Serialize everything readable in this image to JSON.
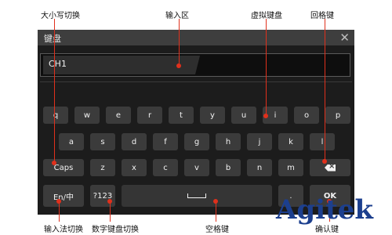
{
  "annotations": {
    "case_switch": "大小写切换",
    "input_area": "输入区",
    "virtual_keyboard": "虚拟键盘",
    "backspace": "回格键",
    "input_method_switch": "输入法切换",
    "numeric_keyboard_switch": "数字键盘切换",
    "space_key": "空格键",
    "confirm_key": "确认键"
  },
  "dialog": {
    "title": "键盘",
    "close_icon": "close-icon"
  },
  "input": {
    "value": "CH1"
  },
  "keys": {
    "row1": [
      "q",
      "w",
      "e",
      "r",
      "t",
      "y",
      "u",
      "i",
      "o",
      "p"
    ],
    "row2": [
      "a",
      "s",
      "d",
      "f",
      "g",
      "h",
      "j",
      "k",
      "l"
    ],
    "row3": [
      "z",
      "x",
      "c",
      "v",
      "b",
      "n",
      "m"
    ],
    "caps": "Caps",
    "backspace_icon": "backspace-icon",
    "lang": "En/中",
    "num": "?123",
    "dot": ".",
    "ok": "OK"
  },
  "brand": {
    "text": "Agitek"
  },
  "colors": {
    "annotation_line": "#e0301c",
    "brand": "#1c3f8e",
    "keyboard_bg": "#1c1c1c",
    "key_bg": "#3b3b3b"
  }
}
